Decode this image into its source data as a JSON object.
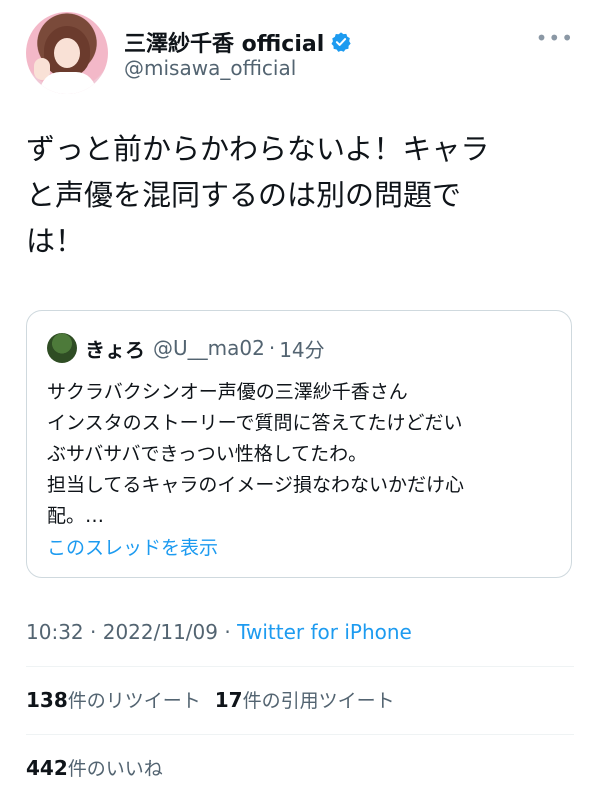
{
  "author": {
    "display_name": "三澤紗千香 official",
    "handle": "@misawa_official",
    "verified": true
  },
  "more_icon": "more-horizontal-icon",
  "tweet": {
    "text": "ずっと前からかわらないよ！キャラ\nと声優を混同するのは別の問題で\nは！"
  },
  "quote": {
    "name": "きょろ",
    "handle": "@U__ma02",
    "dot": "·",
    "time": "14分",
    "text": "サクラバクシンオー声優の三澤紗千香さん\nインスタのストーリーで質問に答えてたけどだい\nぶサバサバできっつい性格してたわ。\n担当してるキャラのイメージ損なわないかだけ心\n配。…",
    "thread_link": "このスレッドを表示"
  },
  "meta": {
    "time": "10:32",
    "sep1": " · ",
    "date": "2022/11/09",
    "sep2": " · ",
    "source": "Twitter for iPhone"
  },
  "stats": {
    "retweets_count": "138",
    "retweets_label": "件のリツイート",
    "quotes_count": "17",
    "quotes_label": "件の引用ツイート",
    "likes_count": "442",
    "likes_label": "件のいいね"
  },
  "colors": {
    "accent": "#1d9bf0",
    "text": "#0f1419",
    "muted": "#536471"
  }
}
